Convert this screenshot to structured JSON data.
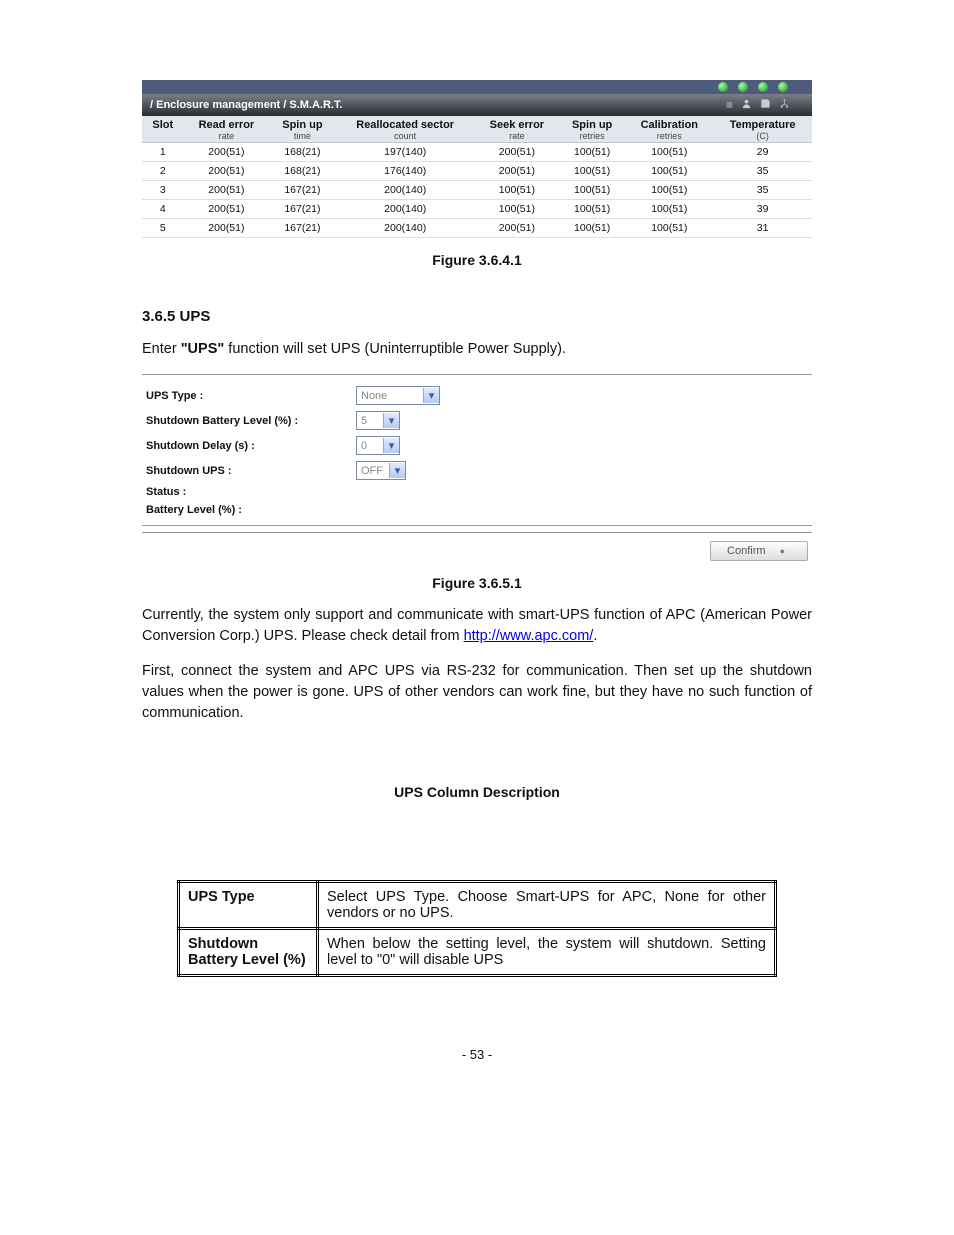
{
  "smart": {
    "breadcrumb": "/ Enclosure management / S.M.A.R.T.",
    "tray_icons": [
      "list-icon",
      "person-icon",
      "save-icon",
      "tree-icon"
    ],
    "columns": [
      {
        "title": "Slot",
        "sub": ""
      },
      {
        "title": "Read error",
        "sub": "rate"
      },
      {
        "title": "Spin up",
        "sub": "time"
      },
      {
        "title": "Reallocated sector",
        "sub": "count"
      },
      {
        "title": "Seek error",
        "sub": "rate"
      },
      {
        "title": "Spin up",
        "sub": "retries"
      },
      {
        "title": "Calibration",
        "sub": "retries"
      },
      {
        "title": "Temperature",
        "sub": "(C)"
      }
    ],
    "rows": [
      {
        "slot": "1",
        "c1": "200(51)",
        "c2": "168(21)",
        "c3": "197(140)",
        "c4": "200(51)",
        "c5": "100(51)",
        "c6": "100(51)",
        "c7": "29"
      },
      {
        "slot": "2",
        "c1": "200(51)",
        "c2": "168(21)",
        "c3": "176(140)",
        "c4": "200(51)",
        "c5": "100(51)",
        "c6": "100(51)",
        "c7": "35"
      },
      {
        "slot": "3",
        "c1": "200(51)",
        "c2": "167(21)",
        "c3": "200(140)",
        "c4": "100(51)",
        "c5": "100(51)",
        "c6": "100(51)",
        "c7": "35"
      },
      {
        "slot": "4",
        "c1": "200(51)",
        "c2": "167(21)",
        "c3": "200(140)",
        "c4": "100(51)",
        "c5": "100(51)",
        "c6": "100(51)",
        "c7": "39"
      },
      {
        "slot": "5",
        "c1": "200(51)",
        "c2": "167(21)",
        "c3": "200(140)",
        "c4": "200(51)",
        "c5": "100(51)",
        "c6": "100(51)",
        "c7": "31"
      }
    ],
    "figure_caption": "Figure 3.6.4.1"
  },
  "ups_section_title": "3.6.5   UPS",
  "ups_intro_prefix": "Enter ",
  "ups_intro_bold": "\"UPS\"",
  "ups_intro_rest": " function will set UPS (Uninterruptible Power Supply).",
  "ups_form": {
    "labels": {
      "type": "UPS Type :",
      "batt": "Shutdown Battery Level (%) :",
      "delay": "Shutdown Delay (s) :",
      "shut": "Shutdown UPS :",
      "status": "Status :",
      "level": "Battery Level (%) :"
    },
    "values": {
      "type": "None",
      "batt": "5",
      "delay": "0",
      "shut": "OFF"
    },
    "confirm": "Confirm"
  },
  "ups_figure_caption": "Figure 3.6.5.1",
  "para1_a": "Currently, the system only support and communicate with smart-UPS function of APC (American Power Conversion Corp.) UPS. Please check detail from ",
  "para1_link": "http://www.apc.com/",
  "para1_b": ".",
  "para2": "First, connect the system and APC UPS via RS-232 for communication. Then set up the shutdown values when the power is gone. UPS of other vendors can work fine, but they have no such function of communication.",
  "opt_header": "UPS Column Description",
  "opt_rows": [
    {
      "k": "UPS Type",
      "v": "Select UPS Type. Choose Smart-UPS for APC, None for other vendors or no UPS."
    },
    {
      "k": "Shutdown Battery Level (%)",
      "v": "When below the setting level, the system will shutdown. Setting level to \"0\" will disable UPS"
    }
  ],
  "page_number": "- 53 -"
}
